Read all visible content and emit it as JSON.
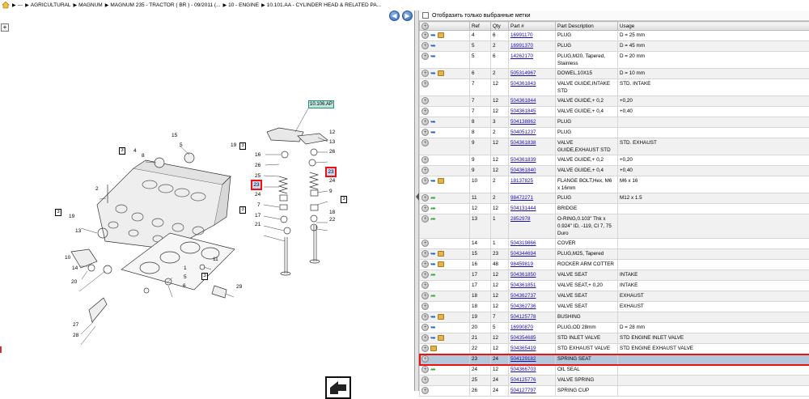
{
  "breadcrumb": {
    "items": [
      "--- ",
      "AGRICULTURAL",
      "MAGNUM",
      "MAGNUM 235 - TRACTOR ( BR ) - 09/2011 (...",
      "10 - ENGINE",
      "10.101.AA - CYLINDER HEAD & RELATED PA..."
    ]
  },
  "filter": {
    "label": "Отобразить только выбранные метки"
  },
  "grid": {
    "headers": [
      "",
      "Ref",
      "Qty",
      "Part #",
      "Part Description",
      "Usage"
    ],
    "rows": [
      {
        "icons": "add,arrow,box",
        "ref": "4",
        "qty": "6",
        "part": "16991170",
        "desc": "PLUG",
        "usage": "D = 25 mm"
      },
      {
        "icons": "add,arrow",
        "ref": "5",
        "qty": "2",
        "part": "16991370",
        "desc": "PLUG",
        "usage": "D = 45 mm"
      },
      {
        "icons": "add,arrow",
        "ref": "5",
        "qty": "6",
        "part": "14262170",
        "desc": "PLUG,M20, Tapered, Stainless",
        "usage": "D = 20 mm"
      },
      {
        "icons": "add,arrow,box",
        "ref": "6",
        "qty": "2",
        "part": "505314967",
        "desc": "DOWEL,10X15",
        "usage": "D = 10 mm"
      },
      {
        "icons": "add",
        "ref": "7",
        "qty": "12",
        "part": "504361843",
        "desc": "VALVE GUIDE,INTAKE STD",
        "usage": "STD. INTAKE"
      },
      {
        "icons": "add",
        "ref": "7",
        "qty": "12",
        "part": "504361844",
        "desc": "VALVE GUIDE,+ 0,2",
        "usage": "+0,20"
      },
      {
        "icons": "add",
        "ref": "7",
        "qty": "12",
        "part": "504361845",
        "desc": "VALVE GUIDE,+ 0,4",
        "usage": "+0,40"
      },
      {
        "icons": "add,arrow",
        "ref": "8",
        "qty": "3",
        "part": "504138862",
        "desc": "PLUG",
        "usage": ""
      },
      {
        "icons": "add,arrow",
        "ref": "8",
        "qty": "2",
        "part": "504051237",
        "desc": "PLUG",
        "usage": ""
      },
      {
        "icons": "add",
        "ref": "9",
        "qty": "12",
        "part": "504361838",
        "desc": "VALVE GUIDE,EXHAUST STD",
        "usage": "STD. EXHAUST"
      },
      {
        "icons": "add",
        "ref": "9",
        "qty": "12",
        "part": "504361839",
        "desc": "VALVE GUIDE,+ 0,2",
        "usage": "+0,20"
      },
      {
        "icons": "add",
        "ref": "9",
        "qty": "12",
        "part": "504361840",
        "desc": "VALVE GUIDE,+ 0,4",
        "usage": "+0,40"
      },
      {
        "icons": "add,arrow,box",
        "ref": "10",
        "qty": "2",
        "part": "18137825",
        "desc": "FLANGE BOLT,Hex, M6 x 16mm",
        "usage": "M6 x 16"
      },
      {
        "icons": "add,green",
        "ref": "11",
        "qty": "2",
        "part": "98472271",
        "desc": "PLUG",
        "usage": "M12 x 1.5"
      },
      {
        "icons": "add,green",
        "ref": "12",
        "qty": "12",
        "part": "504131444",
        "desc": "BRIDGE",
        "usage": ""
      },
      {
        "icons": "add,green",
        "ref": "13",
        "qty": "1",
        "part": "2852978",
        "desc": "O-RING,0.103\" Thk x 0.924\" ID, -119, Cl 7, 75 Duro",
        "usage": ""
      },
      {
        "icons": "add",
        "ref": "14",
        "qty": "1",
        "part": "504319866",
        "desc": "COVER",
        "usage": ""
      },
      {
        "icons": "add,arrow,box",
        "ref": "15",
        "qty": "23",
        "part": "504344694",
        "desc": "PLUG,M25, Tapered",
        "usage": ""
      },
      {
        "icons": "add,arrow,box",
        "ref": "16",
        "qty": "48",
        "part": "98459819",
        "desc": "ROCKER ARM COTTER",
        "usage": ""
      },
      {
        "icons": "add,green",
        "ref": "17",
        "qty": "12",
        "part": "504361850",
        "desc": "VALVE SEAT",
        "usage": "INTAKE"
      },
      {
        "icons": "add",
        "ref": "17",
        "qty": "12",
        "part": "504361851",
        "desc": "VALVE SEAT,+ 0,20",
        "usage": "INTAKE"
      },
      {
        "icons": "add,green",
        "ref": "18",
        "qty": "12",
        "part": "504362737",
        "desc": "VALVE SEAT",
        "usage": "EXHAUST"
      },
      {
        "icons": "add",
        "ref": "18",
        "qty": "12",
        "part": "504362736",
        "desc": "VALVE SEAT",
        "usage": "EXHAUST"
      },
      {
        "icons": "add,arrow,box",
        "ref": "19",
        "qty": "7",
        "part": "504125778",
        "desc": "BUSHING",
        "usage": ""
      },
      {
        "icons": "add,arrow",
        "ref": "20",
        "qty": "5",
        "part": "16990870",
        "desc": "PLUG,OD 28mm",
        "usage": "D = 28 mm"
      },
      {
        "icons": "add,arrow,box",
        "ref": "21",
        "qty": "12",
        "part": "504354685",
        "desc": "STD INLET VALVE",
        "usage": "STD ENGINE INLET VALVE"
      },
      {
        "icons": "add,box",
        "ref": "22",
        "qty": "12",
        "part": "504365419",
        "desc": "STD EXHAUST VALVE",
        "usage": "STD ENGINE EXHAUST VALVE"
      },
      {
        "icons": "add",
        "ref": "23",
        "qty": "24",
        "part": "504129182",
        "desc": "SPRING SEAT",
        "usage": "",
        "selected": true
      },
      {
        "icons": "add,green",
        "ref": "24",
        "qty": "12",
        "part": "504366703",
        "desc": "OIL SEAL",
        "usage": ""
      },
      {
        "icons": "add",
        "ref": "25",
        "qty": "24",
        "part": "504125776",
        "desc": "VALVE SPRING",
        "usage": ""
      },
      {
        "icons": "add",
        "ref": "26",
        "qty": "24",
        "part": "504127797",
        "desc": "SPRING CUP",
        "usage": ""
      }
    ]
  },
  "diagram": {
    "tag": "10.106.AP",
    "callouts": [
      "1",
      "2",
      "3",
      "4",
      "5",
      "6",
      "7",
      "8",
      "9",
      "10",
      "11",
      "12",
      "13",
      "14",
      "15",
      "16",
      "17",
      "18",
      "19",
      "20",
      "21",
      "22",
      "23",
      "24",
      "25",
      "26",
      "27",
      "28",
      "29"
    ],
    "bracket_mark": "3",
    "selected_ref": "23"
  },
  "colors": {
    "selection_outline": "#e11111",
    "selected_row": "#b4c8dc",
    "link": "#1a0dab"
  }
}
